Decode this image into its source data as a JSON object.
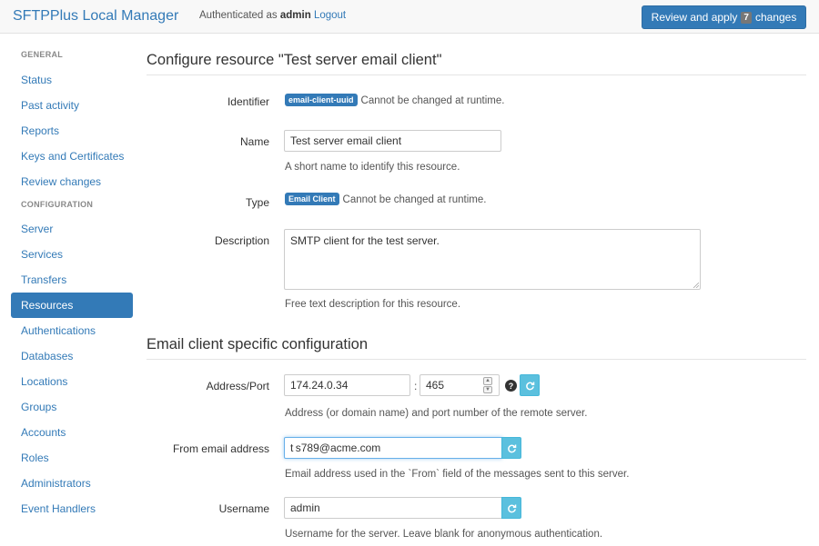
{
  "header": {
    "brand": "SFTPPlus Local Manager",
    "auth_prefix": "Authenticated as",
    "auth_user": "admin",
    "logout": "Logout",
    "review_prefix": "Review and apply",
    "review_count": "7",
    "review_suffix": "changes"
  },
  "sidebar": {
    "general_header": "GENERAL",
    "general_items": [
      "Status",
      "Past activity",
      "Reports",
      "Keys and Certificates",
      "Review changes"
    ],
    "config_header": "CONFIGURATION",
    "config_items": [
      "Server",
      "Services",
      "Transfers",
      "Resources",
      "Authentications",
      "Databases",
      "Locations",
      "Groups",
      "Accounts",
      "Roles",
      "Administrators",
      "Event Handlers"
    ],
    "active_item": "Resources"
  },
  "configure": {
    "title": "Configure resource \"Test server email client\"",
    "identifier_label": "Identifier",
    "identifier_badge": "email-client-uuid",
    "identifier_note": "Cannot be changed at runtime.",
    "name_label": "Name",
    "name_value": "Test server email client",
    "name_help": "A short name to identify this resource.",
    "type_label": "Type",
    "type_badge": "Email Client",
    "type_note": "Cannot be changed at runtime.",
    "description_label": "Description",
    "description_value": "SMTP client for the test server.",
    "description_help": "Free text description for this resource."
  },
  "email": {
    "title": "Email client specific configuration",
    "address_label": "Address/Port",
    "address_value": "174.24.0.34",
    "colon": ":",
    "port_value": "465",
    "address_help": "Address (or domain name) and port number of the remote server.",
    "from_label": "From email address",
    "from_value": "t s789@acme.com",
    "from_help": "Email address used in the `From` field of the messages sent to this server.",
    "username_label": "Username",
    "username_value": "admin",
    "username_help": "Username for the server. Leave blank for anonymous authentication."
  },
  "colors": {
    "accent": "#337ab7",
    "info_button": "#5bc0de"
  },
  "icons": {
    "reset": "refresh-icon",
    "help": "question-circle-icon"
  }
}
